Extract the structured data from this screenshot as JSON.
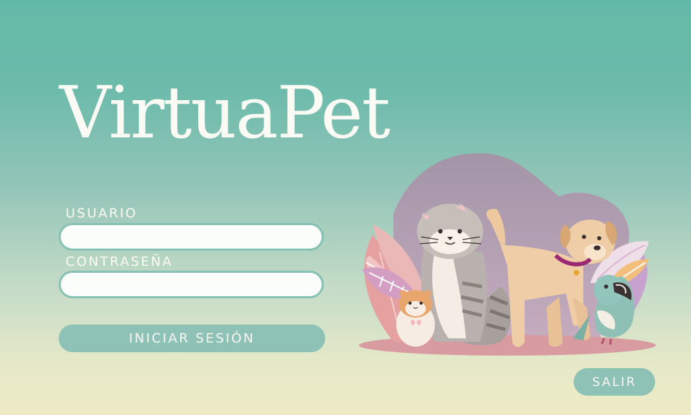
{
  "app": {
    "title": "VirtuaPet"
  },
  "login": {
    "user_label": "USUARIO",
    "user_value": "",
    "password_label": "CONTRASEÑA",
    "password_value": "",
    "submit_label": "INICIAR SESIÓN"
  },
  "footer": {
    "exit_label": "SALIR"
  },
  "illustration": {
    "animals": [
      "hamster-icon",
      "cat-icon",
      "dog-icon",
      "parrot-icon"
    ]
  },
  "colors": {
    "background_top": "#63b9a7",
    "background_bottom": "#eeeac6",
    "button": "#8fc2b6",
    "field_border": "#84c1b3",
    "text_light": "#fbfaf4"
  }
}
